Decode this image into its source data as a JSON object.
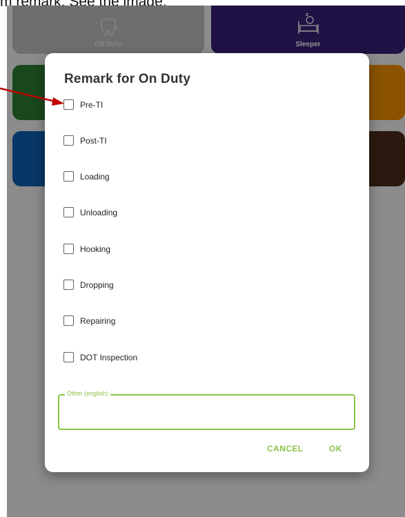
{
  "caption": "m remark. See the image.",
  "background_tiles": {
    "off_duty_label": "Off Duty",
    "sleeper_label": "Sleeper"
  },
  "dialog": {
    "title": "Remark for On Duty",
    "options": [
      {
        "label": "Pre-TI",
        "checked": false
      },
      {
        "label": "Post-TI",
        "checked": false
      },
      {
        "label": "Loading",
        "checked": false
      },
      {
        "label": "Unloading",
        "checked": false
      },
      {
        "label": "Hooking",
        "checked": false
      },
      {
        "label": "Dropping",
        "checked": false
      },
      {
        "label": "Repairing",
        "checked": false
      },
      {
        "label": "DOT Inspection",
        "checked": false
      }
    ],
    "other_field": {
      "label": "Other (english)",
      "value": ""
    },
    "cancel_label": "CANCEL",
    "ok_label": "OK"
  },
  "colors": {
    "accent": "#8bc34a",
    "arrow": "#c00000",
    "sleeper_tile": "#3a1f78",
    "on_duty_tile": "#2e7d32",
    "driving_tile": "#ef8f00",
    "blue_tile": "#0d5fb0",
    "brown_tile": "#4a2c1d",
    "off_duty_tile": "#bdbdbd"
  },
  "icons": {
    "off_duty": "tooth-sleep-icon",
    "sleeper": "bed-sleep-icon"
  }
}
